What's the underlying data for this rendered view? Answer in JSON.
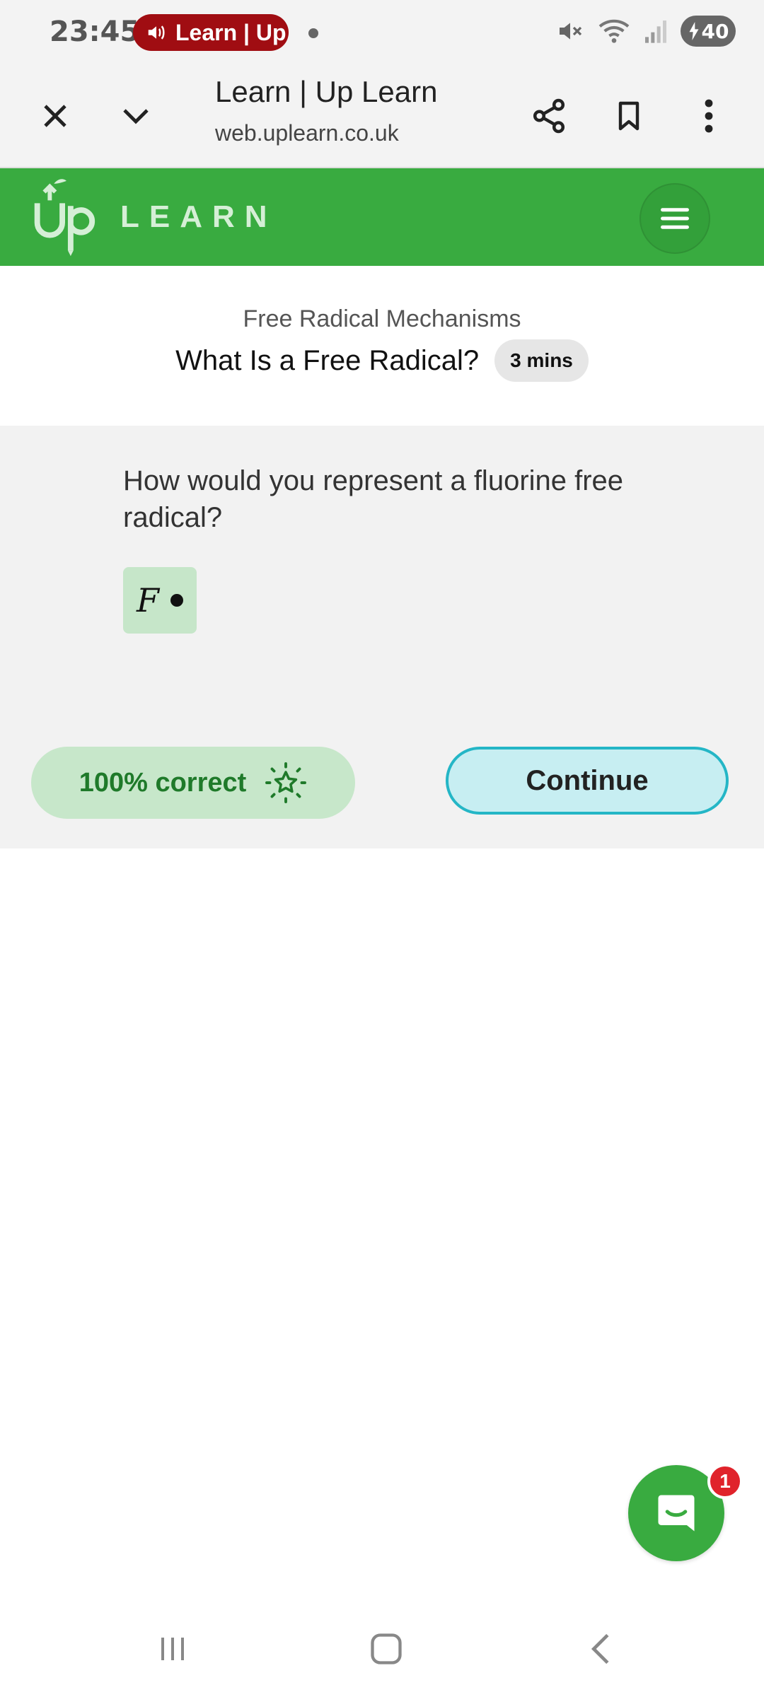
{
  "status_bar": {
    "time": "23:45",
    "media_label": "Learn | Up",
    "battery": "40",
    "icons": [
      "mute-icon",
      "wifi-icon",
      "signal-icon",
      "charging-icon"
    ]
  },
  "browser": {
    "title": "Learn | Up Learn",
    "url": "web.uplearn.co.uk",
    "icons": [
      "close-icon",
      "chevron-down-icon",
      "share-icon",
      "bookmark-icon",
      "more-vert-icon"
    ]
  },
  "site": {
    "logo_text": "LEARN",
    "brand_color": "#39ab40"
  },
  "lesson": {
    "course": "Free Radical Mechanisms",
    "title": "What Is a Free Radical?",
    "duration": "3 mins"
  },
  "question": {
    "text": "How would you represent a fluorine free radical?",
    "answer_symbol": "F"
  },
  "result": {
    "score": "100% correct",
    "continue_label": "Continue"
  },
  "chat": {
    "count": "1"
  },
  "nav": {
    "icons": [
      "recents-icon",
      "home-icon",
      "back-icon"
    ]
  }
}
